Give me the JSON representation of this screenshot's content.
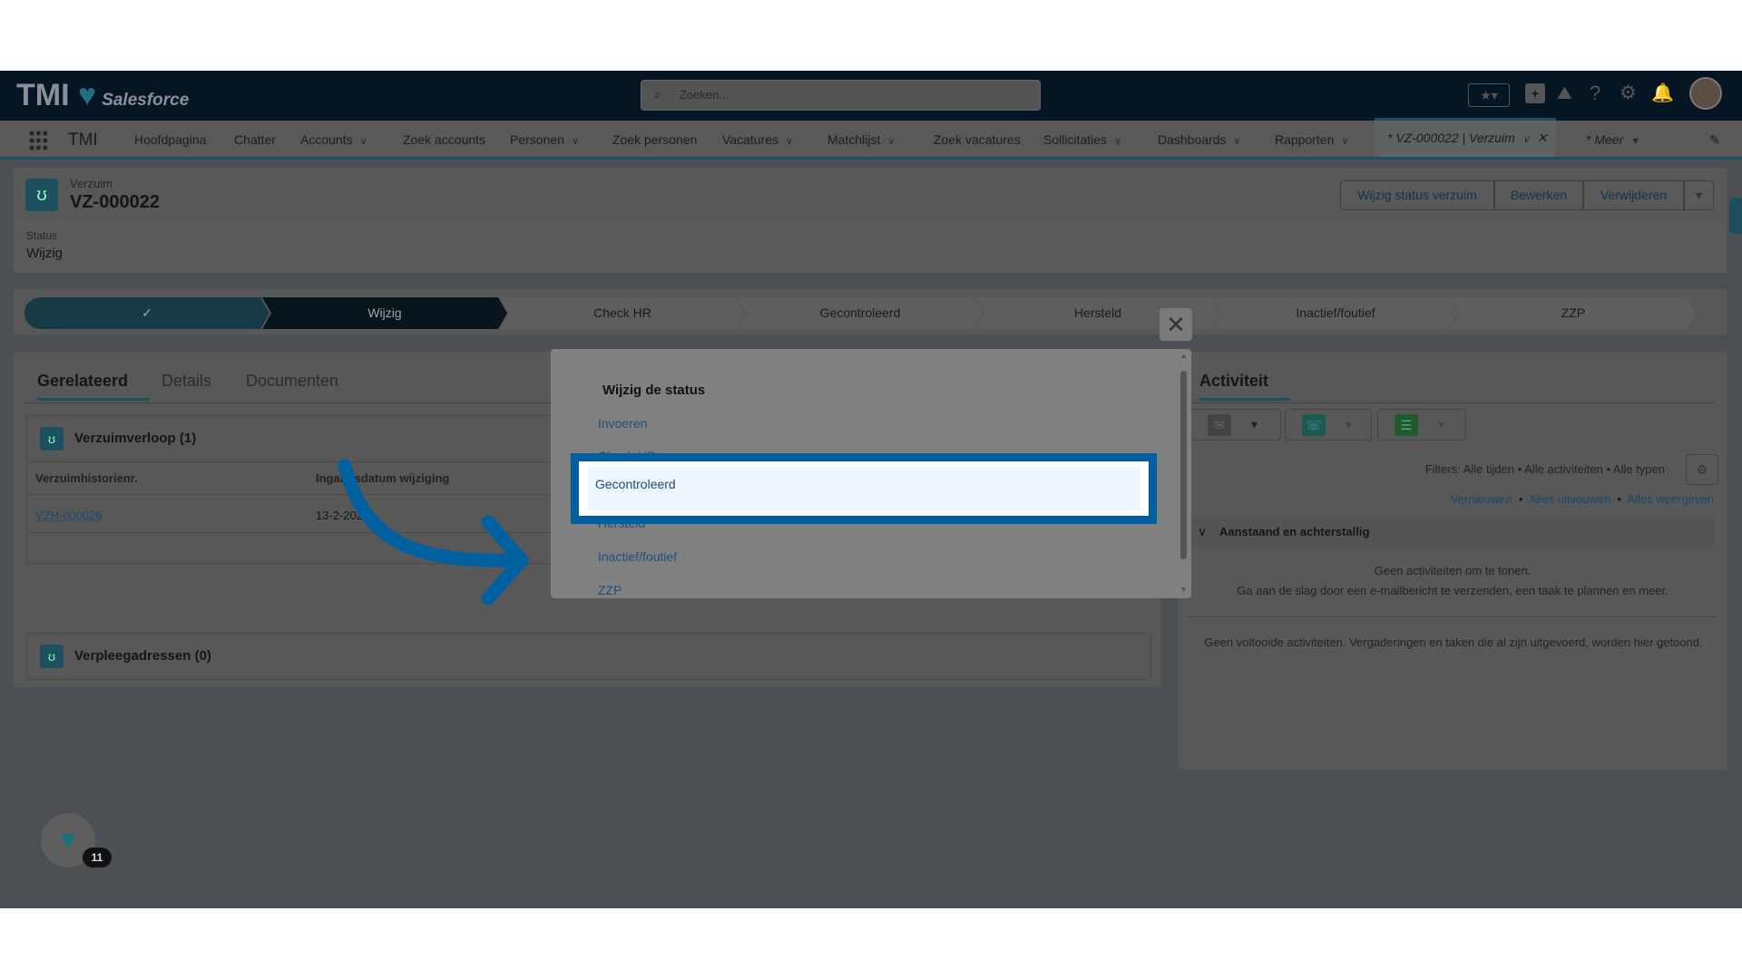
{
  "header": {
    "logo_text": "TMI",
    "logo_sub": "Salesforce",
    "search_placeholder": "Zoeken..."
  },
  "nav": {
    "app_name": "TMI",
    "items": [
      {
        "label": "Hoofdpagina",
        "dropdown": false
      },
      {
        "label": "Chatter",
        "dropdown": false
      },
      {
        "label": "Accounts",
        "dropdown": true
      },
      {
        "label": "Zoek accounts",
        "dropdown": false
      },
      {
        "label": "Personen",
        "dropdown": true
      },
      {
        "label": "Zoek personen",
        "dropdown": false
      },
      {
        "label": "Vacatures",
        "dropdown": true
      },
      {
        "label": "Matchlijst",
        "dropdown": true
      },
      {
        "label": "Zoek vacatures",
        "dropdown": false
      },
      {
        "label": "Sollicitaties",
        "dropdown": true
      },
      {
        "label": "Dashboards",
        "dropdown": true
      },
      {
        "label": "Rapporten",
        "dropdown": true
      }
    ],
    "active_tab": "* VZ-000022 | Verzuim",
    "more": "* Meer"
  },
  "record": {
    "object": "Verzuim",
    "title": "VZ-000022",
    "status_label": "Status",
    "status_value": "Wijzig",
    "buttons": [
      "Wijzig status verzuim",
      "Bewerken",
      "Verwijderen"
    ]
  },
  "path": {
    "steps": [
      "✓",
      "Wijzig",
      "Check HR",
      "Gecontroleerd",
      "Hersteld",
      "Inactief/foutief",
      "ZZP"
    ],
    "current": "Wijzig"
  },
  "tabs": [
    "Gerelateerd",
    "Details",
    "Documenten"
  ],
  "related": {
    "list1_title": "Verzuimverloop (1)",
    "columns": [
      "Verzuimhistorienr.",
      "Ingangsdatum wijziging"
    ],
    "rows": [
      [
        "VZH-000026",
        "13-2-2025"
      ]
    ],
    "list2_title": "Verpleegadressen (0)"
  },
  "modal": {
    "title": "Wijzig de status",
    "options": [
      "Invoeren",
      "Check HR",
      "Gecontroleerd",
      "Hersteld",
      "Inactief/foutief",
      "ZZP"
    ],
    "highlighted": "Gecontroleerd"
  },
  "activity": {
    "title": "Activiteit",
    "filters": "Filters: Alle tijden • Alle activiteiten • Alle typen",
    "links": [
      "Vernieuwen",
      "Alles uitvouwen",
      "Alles weergeven"
    ],
    "section": "Aanstaand en achterstallig",
    "empty1": "Geen activiteiten om te tonen.",
    "empty2": "Ga aan de slag door een e-mailbericht te verzenden, een taak te plannen en meer.",
    "empty3": "Geen voltooide activiteiten. Vergaderingen en taken die al zijn uitgevoerd, worden hier getoond."
  },
  "badge_count": "11",
  "colors": {
    "accent": "#0060a0",
    "header": "#061524",
    "highlight_fill": "#eef6fd"
  }
}
